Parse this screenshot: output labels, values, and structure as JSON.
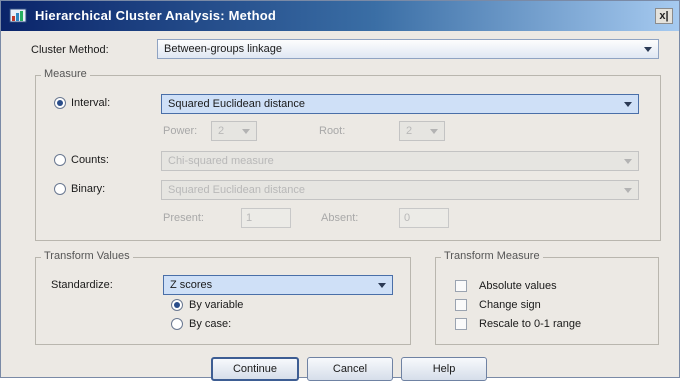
{
  "window": {
    "title": "Hierarchical Cluster Analysis: Method",
    "close_label": "x|"
  },
  "cluster_method": {
    "label": "Cluster Method:",
    "value": "Between-groups linkage"
  },
  "measure": {
    "legend": "Measure",
    "interval": {
      "label": "Interval:",
      "value": "Squared Euclidean distance",
      "selected": true
    },
    "power": {
      "label": "Power:",
      "value": "2"
    },
    "root": {
      "label": "Root:",
      "value": "2"
    },
    "counts": {
      "label": "Counts:",
      "value": "Chi-squared measure",
      "selected": false
    },
    "binary": {
      "label": "Binary:",
      "value": "Squared Euclidean distance",
      "selected": false
    },
    "present": {
      "label": "Present:",
      "value": "1"
    },
    "absent": {
      "label": "Absent:",
      "value": "0"
    }
  },
  "transform_values": {
    "legend": "Transform Values",
    "standardize_label": "Standardize:",
    "standardize_value": "Z scores",
    "by_variable": "By variable",
    "by_case": "By case:"
  },
  "transform_measure": {
    "legend": "Transform Measure",
    "absolute_values": "Absolute values",
    "change_sign": "Change sign",
    "rescale": "Rescale to 0-1 range"
  },
  "buttons": {
    "continue": "Continue",
    "cancel": "Cancel",
    "help": "Help"
  }
}
